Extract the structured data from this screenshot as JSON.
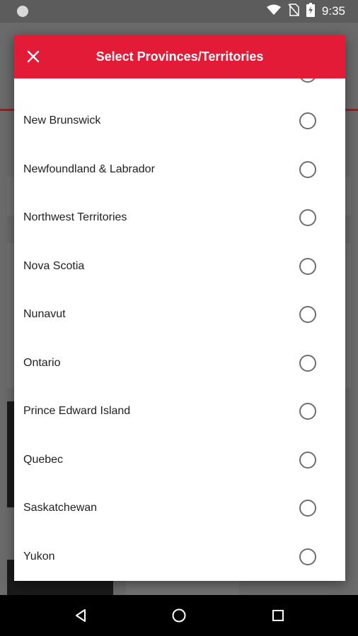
{
  "status_bar": {
    "time": "9:35",
    "icons": [
      "notification-dot-icon",
      "wifi-icon",
      "no-sim-icon",
      "battery-charging-icon"
    ]
  },
  "dialog": {
    "title": "Select Provinces/Territories",
    "close_icon": "close-icon",
    "items": [
      {
        "label": "New Brunswick",
        "selected": false
      },
      {
        "label": "Newfoundland & Labrador",
        "selected": false
      },
      {
        "label": "Northwest Territories",
        "selected": false
      },
      {
        "label": "Nova Scotia",
        "selected": false
      },
      {
        "label": "Nunavut",
        "selected": false
      },
      {
        "label": "Ontario",
        "selected": false
      },
      {
        "label": "Prince Edward Island",
        "selected": false
      },
      {
        "label": "Quebec",
        "selected": false
      },
      {
        "label": "Saskatchewan",
        "selected": false
      },
      {
        "label": "Yukon",
        "selected": false
      }
    ]
  },
  "nav_bar": {
    "buttons": [
      "back-icon",
      "home-icon",
      "recents-icon"
    ]
  },
  "colors": {
    "accent": "#e41b36",
    "radio_border": "#6e6e6e",
    "text": "#212121"
  }
}
